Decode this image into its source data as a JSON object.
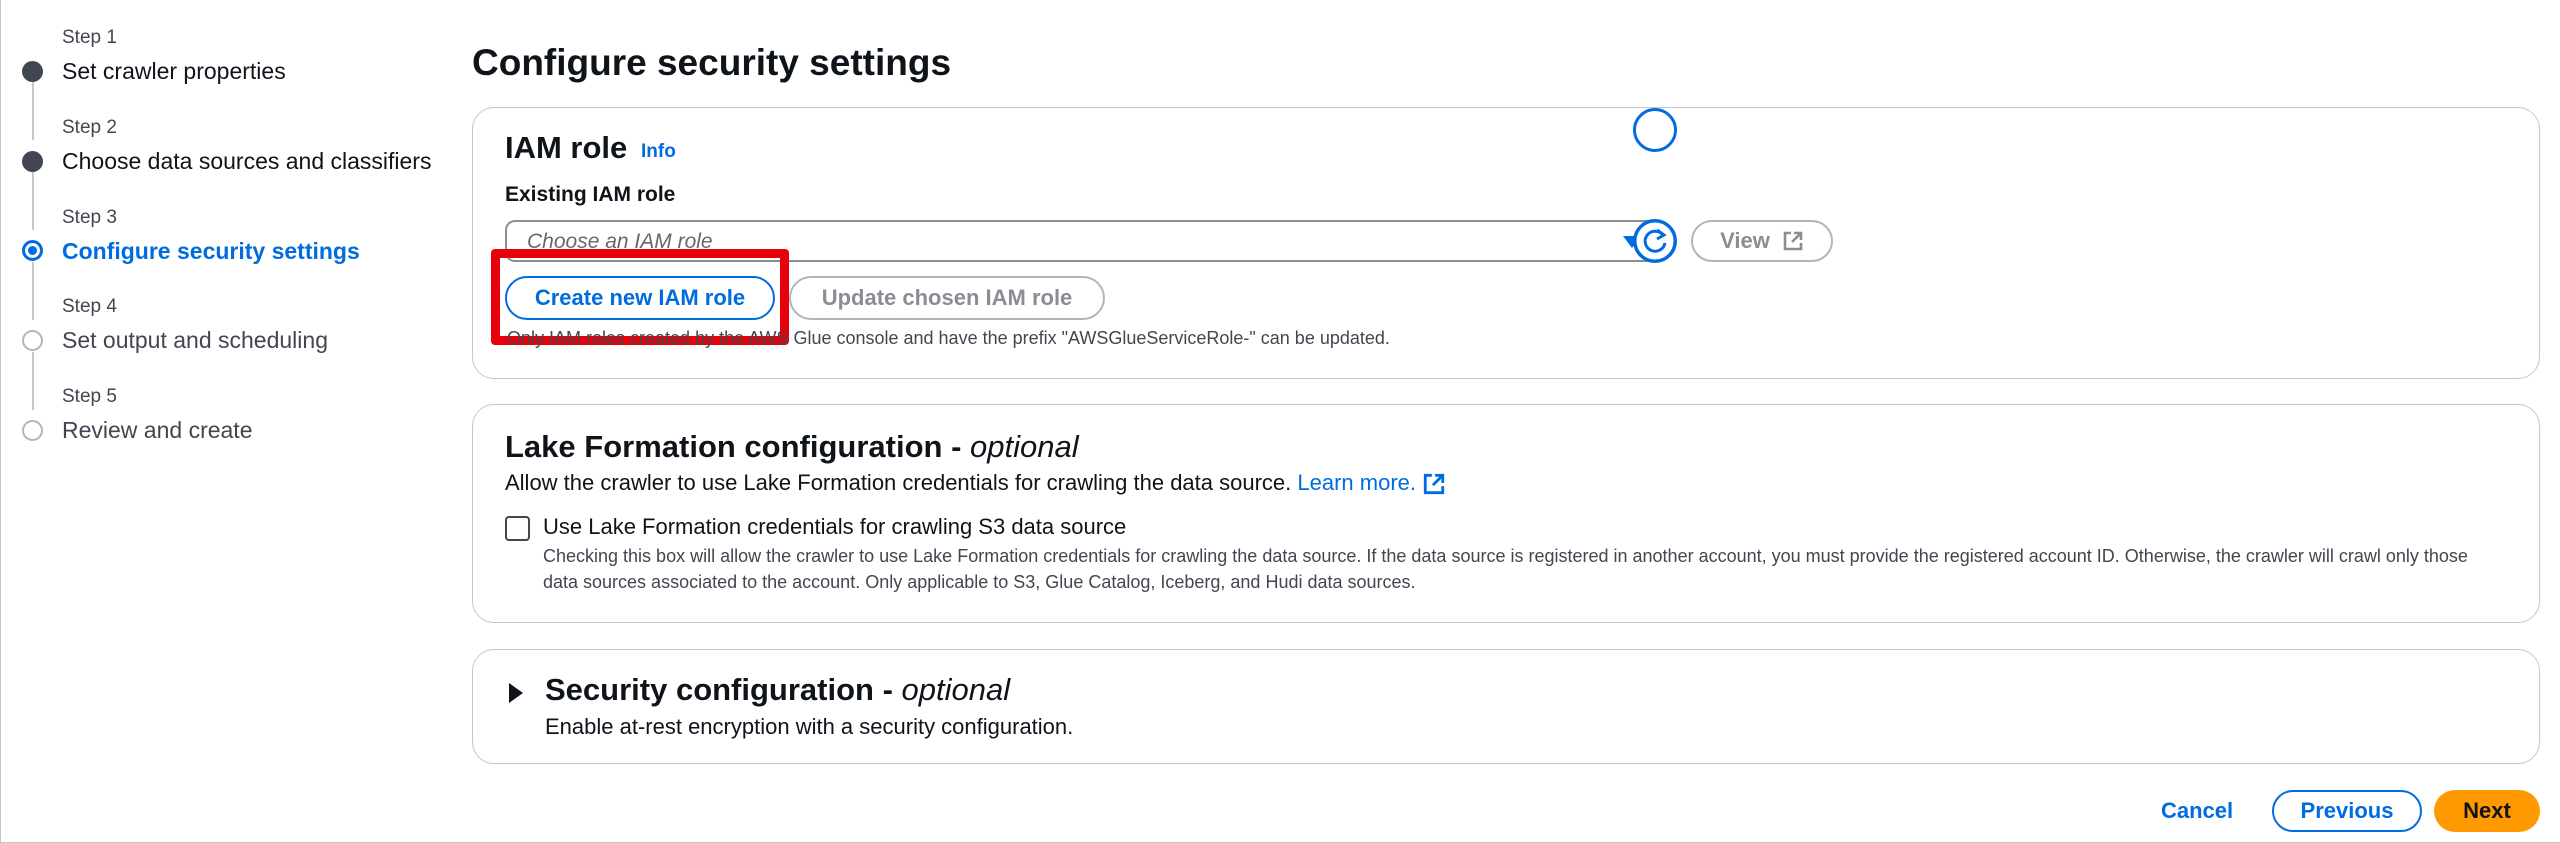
{
  "steps": [
    {
      "num": "Step 1",
      "title": "Set crawler properties",
      "state": "done"
    },
    {
      "num": "Step 2",
      "title": "Choose data sources and classifiers",
      "state": "done"
    },
    {
      "num": "Step 3",
      "title": "Configure security settings",
      "state": "current"
    },
    {
      "num": "Step 4",
      "title": "Set output and scheduling",
      "state": "future"
    },
    {
      "num": "Step 5",
      "title": "Review and create",
      "state": "future"
    }
  ],
  "page_title": "Configure security settings",
  "iam": {
    "heading": "IAM role",
    "info": "Info",
    "field_label": "Existing IAM role",
    "placeholder": "Choose an IAM role",
    "view_label": "View",
    "create_label": "Create new IAM role",
    "update_label": "Update chosen IAM role",
    "note": "Only IAM roles created by the AWS Glue console and have the prefix \"AWSGlueServiceRole-\" can be updated."
  },
  "lake": {
    "heading": "Lake Formation configuration -",
    "heading_opt": "optional",
    "description": "Allow the crawler to use Lake Formation credentials for crawling the data source.",
    "learn_more": "Learn more.",
    "checkbox_label": "Use Lake Formation credentials for crawling S3 data source",
    "checkbox_desc": "Checking this box will allow the crawler to use Lake Formation credentials for crawling the data source. If the data source is registered in another account, you must provide the registered account ID. Otherwise, the crawler will crawl only those data sources associated to the account. Only applicable to S3, Glue Catalog, Iceberg, and Hudi data sources.",
    "checked": false
  },
  "security": {
    "heading": "Security configuration -",
    "heading_opt": "optional",
    "description": "Enable at-rest encryption with a security configuration."
  },
  "footer": {
    "cancel": "Cancel",
    "previous": "Previous",
    "next": "Next"
  },
  "colors": {
    "accent": "#006ce0",
    "primary_button": "#ff9900",
    "highlight": "#e8000a"
  }
}
